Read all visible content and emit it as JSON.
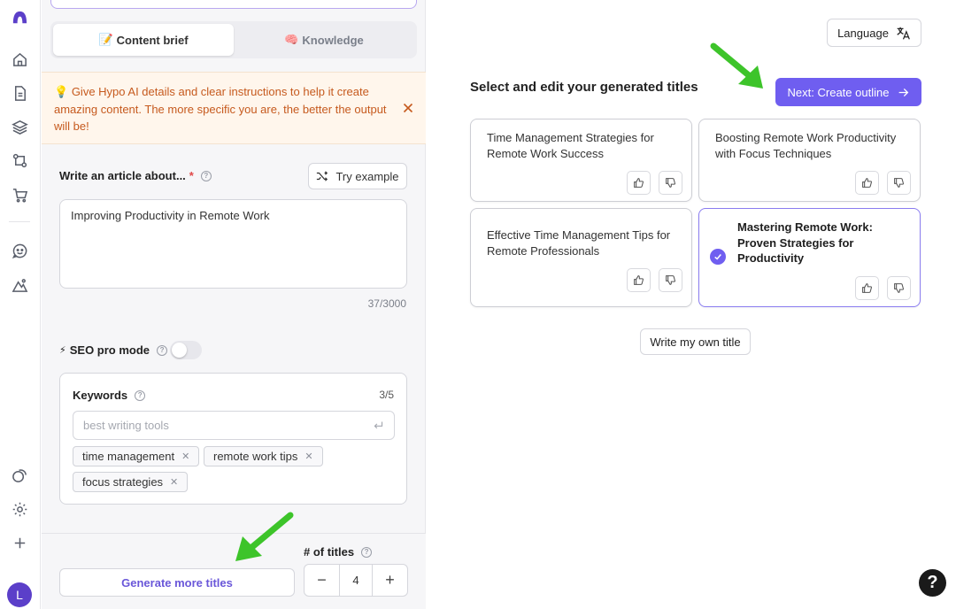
{
  "tabs": {
    "content_brief": "Content brief",
    "content_brief_emoji": "📝",
    "knowledge": "Knowledge",
    "knowledge_emoji": "🧠"
  },
  "notice": {
    "emoji": "💡",
    "text": "Give Hypo AI details and clear instructions to help it create amazing content. The more specific you are, the better the output will be!"
  },
  "article": {
    "label": "Write an article about...",
    "required_mark": "*",
    "try_example": "Try example",
    "value": "Improving Productivity in Remote Work",
    "counter": "37/3000"
  },
  "seo": {
    "emoji": "⚡",
    "label": "SEO pro mode",
    "enabled": false
  },
  "keywords": {
    "label": "Keywords",
    "count": "3/5",
    "placeholder": "best writing tools",
    "chips": [
      "time management",
      "remote work tips",
      "focus strategies"
    ]
  },
  "titles_control": {
    "label": "# of titles",
    "value": "4",
    "minus": "−",
    "plus": "+",
    "generate_label": "Generate more titles"
  },
  "header": {
    "language_label": "Language",
    "section_title": "Select and edit your generated titles",
    "next_label": "Next: Create outline"
  },
  "cards": [
    {
      "title": "Time Management Strategies for Remote Work Success",
      "selected": false
    },
    {
      "title": "Boosting Remote Work Productivity with Focus Techniques",
      "selected": false
    },
    {
      "title": "Effective Time Management Tips for Remote Professionals",
      "selected": false
    },
    {
      "title": "Mastering Remote Work: Proven Strategies for Productivity",
      "selected": true
    }
  ],
  "own_title_label": "Write my own title",
  "help_label": "?",
  "user_initial": "L",
  "colors": {
    "accent": "#6f5ef0",
    "notice_text": "#c65a1e",
    "notice_bg": "#fff6ec",
    "annotation_arrow": "#3dc42a"
  }
}
